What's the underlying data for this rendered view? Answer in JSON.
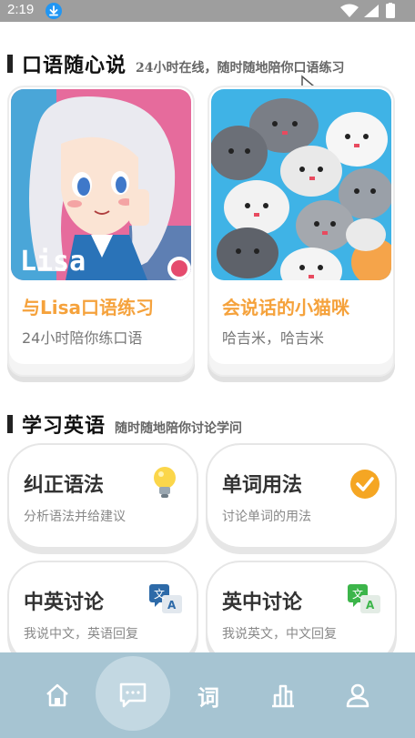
{
  "status_bar": {
    "time": "2:19"
  },
  "speaking_section": {
    "title": "口语随心说",
    "subtitle": "24小时在线，随时随地陪你口语练习",
    "cards": [
      {
        "title": "与Lisa口语练习",
        "subtitle": "24小时陪你练口语",
        "image_label": "Lisa"
      },
      {
        "title": "会说话的小猫咪",
        "subtitle": "哈吉米，哈吉米"
      }
    ]
  },
  "learn_section": {
    "title": "学习英语",
    "subtitle": "随时随地陪你讨论学问",
    "cards": [
      {
        "title": "纠正语法",
        "subtitle": "分析语法并给建议",
        "icon": "lightbulb-icon"
      },
      {
        "title": "单词用法",
        "subtitle": "讨论单词的用法",
        "icon": "check-circle-icon"
      },
      {
        "title": "中英讨论",
        "subtitle": "我说中文，英语回复",
        "icon": "translate-icon"
      },
      {
        "title": "英中讨论",
        "subtitle": "我说英文，中文回复",
        "icon": "translate-icon"
      }
    ]
  },
  "translate_icon_glyphs": {
    "zh": "文",
    "en": "A"
  },
  "bottom_nav": {
    "active_index": 1,
    "items": [
      {
        "icon": "home-icon"
      },
      {
        "icon": "chat-icon"
      },
      {
        "icon": "word-icon",
        "label": "词"
      },
      {
        "icon": "chart-icon"
      },
      {
        "icon": "profile-icon"
      }
    ]
  },
  "colors": {
    "accent": "#f5a23c",
    "nav_bg": "#a6c4d2",
    "nav_active": "#c3d8e2",
    "check": "#f5a623"
  }
}
